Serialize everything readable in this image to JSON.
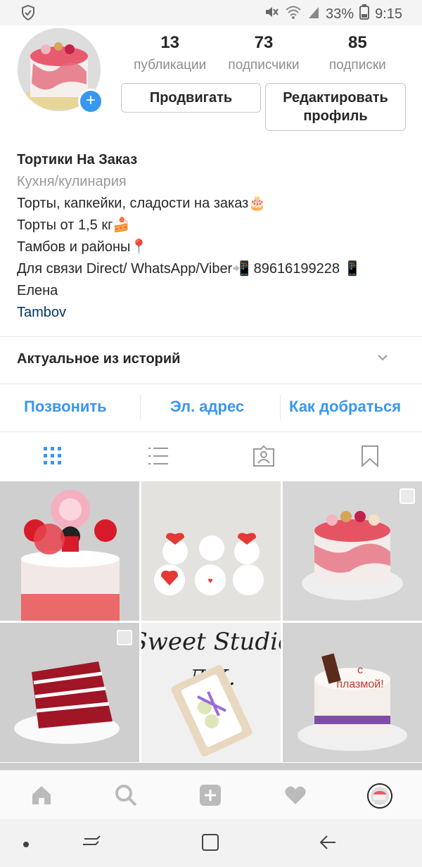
{
  "status": {
    "battery": "33%",
    "time": "9:15",
    "icons": [
      "shield-icon",
      "mute-icon",
      "wifi-icon",
      "signal-icon",
      "battery-icon"
    ]
  },
  "profile": {
    "stats": [
      {
        "num": "13",
        "label": "публикации"
      },
      {
        "num": "73",
        "label": "подписчики"
      },
      {
        "num": "85",
        "label": "подписки"
      }
    ],
    "promote_label": "Продвигать",
    "edit_label_line1": "Редактировать",
    "edit_label_line2": "профиль",
    "name": "Тортики На Заказ",
    "category": "Кухня/кулинария",
    "bio": [
      "Торты, капкейки, сладости на заказ🎂",
      "Торты от 1,5 кг🍰",
      "Тамбов и районы📍",
      "Для связи Direct/ WhatsApp/Viber📲 89616199228 📱",
      "Елена"
    ],
    "location": "Tambov"
  },
  "highlights": {
    "title": "Актуальное из историй"
  },
  "contacts": {
    "call": "Позвонить",
    "email": "Эл. адрес",
    "directions": "Как добраться"
  },
  "colors": {
    "accent": "#3897f0",
    "link": "#003569"
  }
}
